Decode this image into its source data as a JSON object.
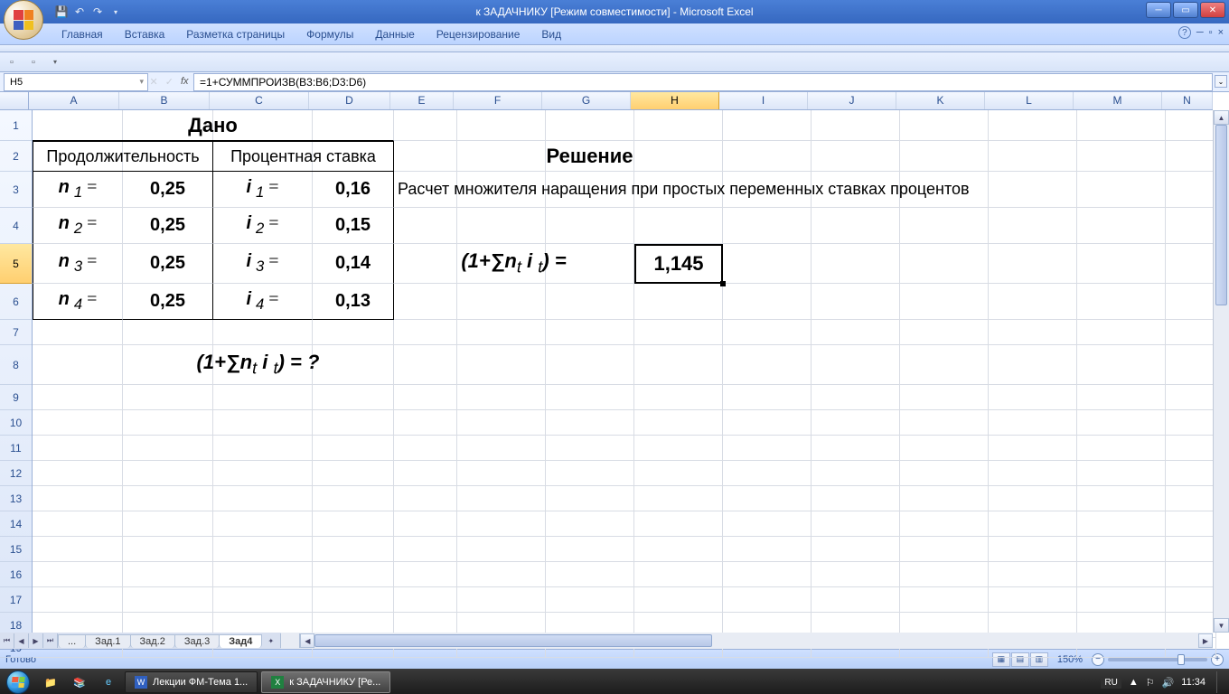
{
  "title": "к ЗАДАЧНИКУ  [Режим совместимости] - Microsoft Excel",
  "ribbon_tabs": [
    "Главная",
    "Вставка",
    "Разметка страницы",
    "Формулы",
    "Данные",
    "Рецензирование",
    "Вид"
  ],
  "name_box": "H5",
  "formula": "=1+СУММПРОИЗВ(B3:B6;D3:D6)",
  "columns": [
    "A",
    "B",
    "C",
    "D",
    "E",
    "F",
    "G",
    "H",
    "I",
    "J",
    "K",
    "L",
    "M",
    "N"
  ],
  "active_col": "H",
  "row_count": 19,
  "active_row": 5,
  "row_heights": {
    "1": 34,
    "2": 34,
    "3": 40,
    "4": 40,
    "5": 44,
    "6": 40,
    "7": 28,
    "8": 44,
    "9": 28,
    "10": 28,
    "11": 28,
    "12": 28,
    "13": 28,
    "14": 28,
    "15": 28,
    "16": 28,
    "17": 28,
    "18": 28,
    "19": 22
  },
  "col_widths": {
    "A": 100,
    "B": 100,
    "C": 110,
    "D": 90,
    "E": 70,
    "F": 98,
    "G": 98,
    "H": 98,
    "I": 98,
    "J": 98,
    "K": 98,
    "L": 98,
    "M": 98,
    "N": 56
  },
  "sheet_tabs": [
    "...",
    "Зад.1",
    "Зад.2",
    "Зад.3",
    "Зад4"
  ],
  "active_sheet": "Зад4",
  "status": "Готово",
  "zoom": "150%",
  "taskbar": {
    "items": [
      {
        "label": "Лекции ФМ-Тема 1...",
        "icon": "word"
      },
      {
        "label": "к ЗАДАЧНИКУ  [Ре...",
        "icon": "excel",
        "active": true
      }
    ],
    "lang": "RU",
    "time": "11:34"
  },
  "content": {
    "dano": "Дано",
    "col_dur": "Продолжительность",
    "col_rate": "Процентная ставка",
    "n1": "n",
    "n1sub": "1",
    "eq": " = ",
    "v_n1": "0,25",
    "i1": "i",
    "i1sub": "1",
    "v_i1": "0,16",
    "n2sub": "2",
    "v_n2": "0,25",
    "i2sub": "2",
    "v_i2": "0,15",
    "n3sub": "3",
    "v_n3": "0,25",
    "i3sub": "3",
    "v_i3": "0,14",
    "n4sub": "4",
    "v_n4": "0,25",
    "i4sub": "4",
    "v_i4": "0,13",
    "question_formula": "(1+∑n",
    "question_sub_t1": "t",
    "question_mid": " i ",
    "question_sub_t2": "t",
    "question_end": ")  =  ?",
    "reshenie": "Решение",
    "desc": "Расчет множителя наращения при простых переменных ставках процентов",
    "result_formula_end": ")  = ",
    "result": "1,145"
  }
}
